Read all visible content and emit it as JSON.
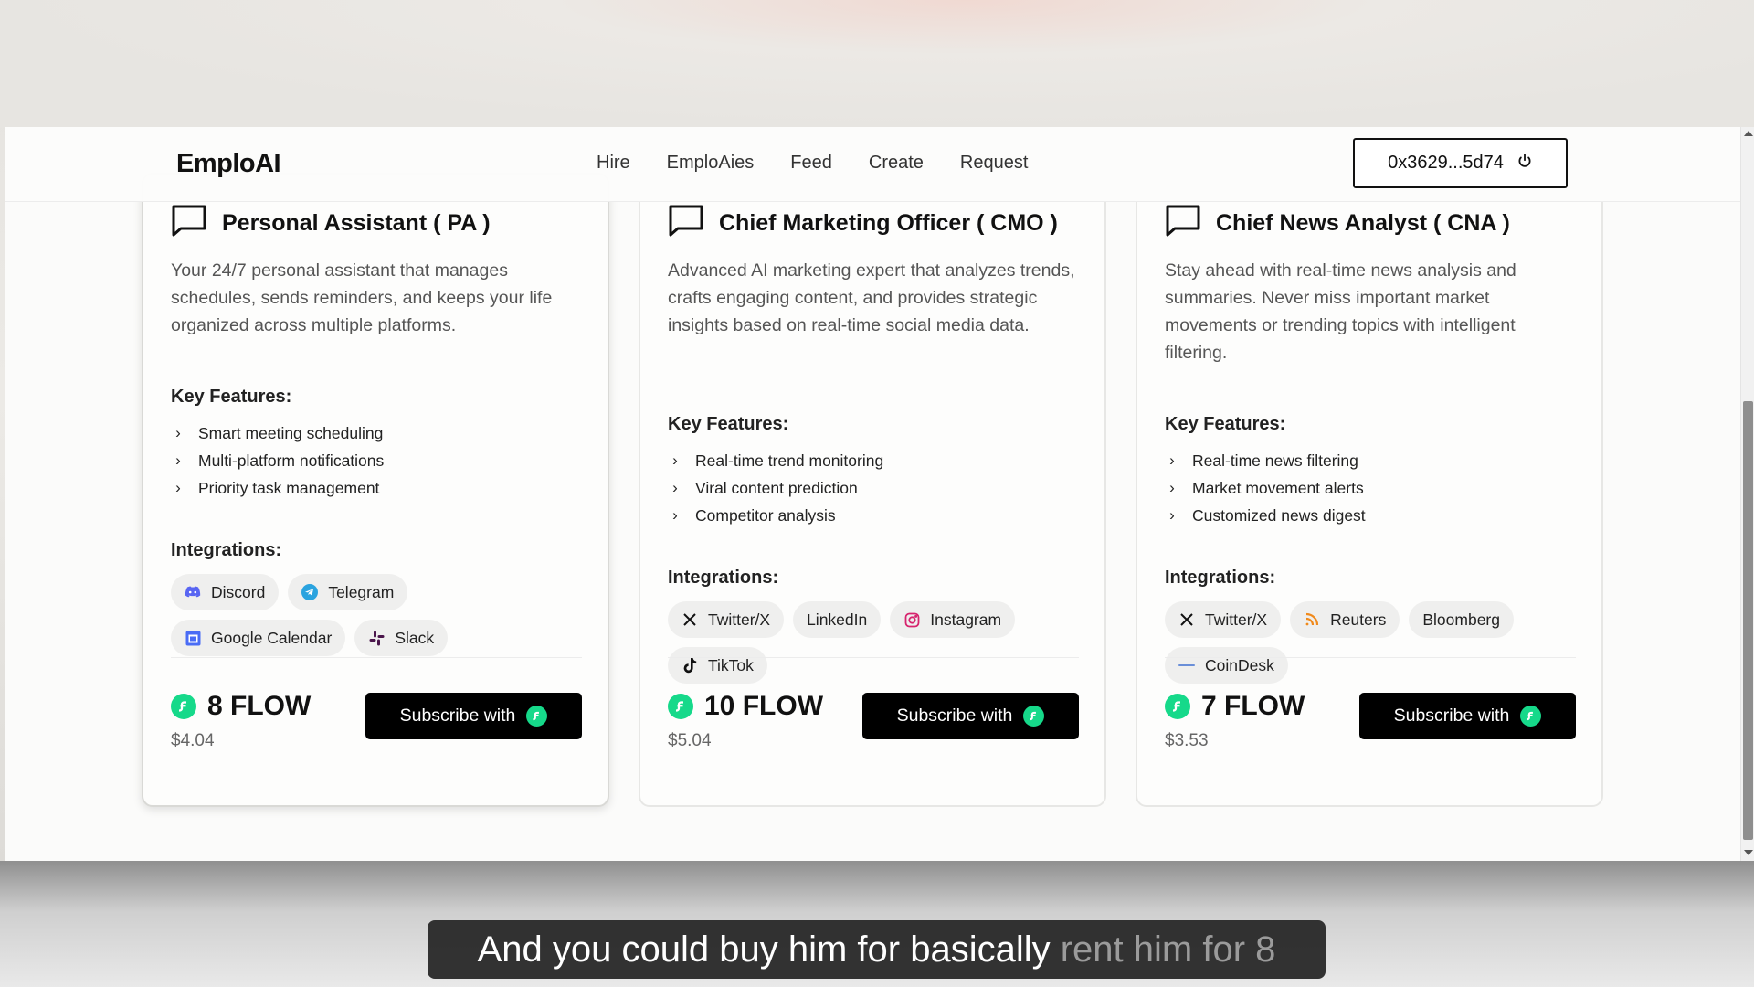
{
  "header": {
    "logo": "EmploAI",
    "nav": [
      "Hire",
      "EmploAies",
      "Feed",
      "Create",
      "Request"
    ],
    "wallet": "0x3629...5d74"
  },
  "cards": [
    {
      "title": "Personal Assistant ( PA )",
      "description": "Your 24/7 personal assistant that manages schedules, sends reminders, and keeps your life organized across multiple platforms.",
      "features_label": "Key Features:",
      "features": [
        "Smart meeting scheduling",
        "Multi-platform notifications",
        "Priority task management"
      ],
      "integrations_label": "Integrations:",
      "integrations": [
        {
          "label": "Discord",
          "icon": "discord-icon"
        },
        {
          "label": "Telegram",
          "icon": "telegram-icon"
        },
        {
          "label": "Google Calendar",
          "icon": "google-calendar-icon"
        },
        {
          "label": "Slack",
          "icon": "slack-icon"
        }
      ],
      "price": "8 FLOW",
      "usd": "$4.04",
      "button": "Subscribe with"
    },
    {
      "title": "Chief Marketing Officer ( CMO )",
      "description": "Advanced AI marketing expert that analyzes trends, crafts engaging content, and provides strategic insights based on real-time social media data.",
      "features_label": "Key Features:",
      "features": [
        "Real-time trend monitoring",
        "Viral content prediction",
        "Competitor analysis"
      ],
      "integrations_label": "Integrations:",
      "integrations": [
        {
          "label": "Twitter/X",
          "icon": "x-icon"
        },
        {
          "label": "LinkedIn",
          "icon": ""
        },
        {
          "label": "Instagram",
          "icon": "instagram-icon"
        },
        {
          "label": "TikTok",
          "icon": "tiktok-icon"
        }
      ],
      "price": "10 FLOW",
      "usd": "$5.04",
      "button": "Subscribe with"
    },
    {
      "title": "Chief News Analyst ( CNA )",
      "description": "Stay ahead with real-time news analysis and summaries. Never miss important market movements or trending topics with intelligent filtering.",
      "features_label": "Key Features:",
      "features": [
        "Real-time news filtering",
        "Market movement alerts",
        "Customized news digest"
      ],
      "integrations_label": "Integrations:",
      "integrations": [
        {
          "label": "Twitter/X",
          "icon": "x-icon"
        },
        {
          "label": "Reuters",
          "icon": "rss-icon"
        },
        {
          "label": "Bloomberg",
          "icon": ""
        },
        {
          "label": "CoinDesk",
          "icon": "dash-icon"
        }
      ],
      "price": "7 FLOW",
      "usd": "$3.53",
      "button": "Subscribe with"
    }
  ],
  "caption": {
    "spoken": "And you could buy him for basically",
    "upcoming": "rent him for 8"
  }
}
